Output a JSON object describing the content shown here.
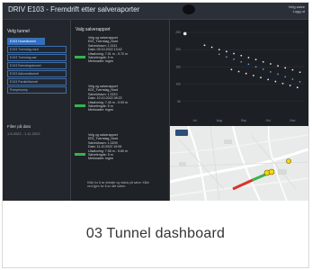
{
  "app": {
    "title": "DRIV E103 - Fremdrift etter salveraporter",
    "user_line1": "Velg salve",
    "user_line2": "Logg ut"
  },
  "left_panel": {
    "heading": "Velg tunnel",
    "tunnels": [
      "E103 Hovedtunnel",
      "E103 Tverrslag nord",
      "E103 Tverrslag sør",
      "E103 Rømningstunnel",
      "E103 Adkomsttunnel",
      "E103 Parallelltunnel",
      "Pumpesump"
    ],
    "filter_label": "Filter på dato",
    "filter_value": "1.6.2022 - 1.11.2022"
  },
  "middle_panel": {
    "heading": "Valg salverapport",
    "reports": [
      {
        "lines": [
          "Velg og salverapport",
          "E03_Tverrslag_Nord",
          "Salveidnavn: 1.0211",
          "Dato: 09.10.2022 13:42",
          "Utsalvning: 7.01 m - 9.72 m",
          "Salvelengde: 5 m",
          "Merknader: Ingen"
        ]
      },
      {
        "lines": [
          "Velg og salverapport",
          "E03_Tverrslag_Nord",
          "Salveidnavn: 1.0210",
          "Dato: 10.10.2022 08:22",
          "Utsalvning: 7.40 m - 9.93 m",
          "Salvelengde: 5 m",
          "Merknader: Ingen"
        ]
      },
      {
        "lines": [
          "Velg og salverapport",
          "E03_Tverrslag_Nord",
          "Salveidnavn: 1.0209",
          "Dato: 11.10.2022 10:06",
          "Utsalvning: 7.55 m - 9.60 m",
          "Salvelengde: 5 m",
          "Merknader: Ingen"
        ]
      }
    ],
    "footer": "Klikk for å se detaljer og status på salve. Klikk ned igjen for å se alle salver."
  },
  "chart_data": {
    "type": "scatter",
    "title": "",
    "xlabel": "",
    "ylabel": "",
    "x_ticks": [
      "Jul",
      "Aug",
      "Sep",
      "Oct",
      "Nov"
    ],
    "y_ticks": [
      "250",
      "200",
      "150",
      "100",
      "50"
    ],
    "ylim": [
      0,
      260
    ],
    "grid": true,
    "series": [
      {
        "color": "#e8edf3",
        "x": [
          0.18,
          0.24,
          0.3,
          0.36,
          0.42,
          0.48,
          0.54,
          0.6,
          0.66,
          0.72,
          0.78,
          0.84,
          0.9,
          0.96
        ],
        "y": [
          205,
          199,
          192,
          186,
          180,
          174,
          168,
          162,
          155,
          149,
          143,
          137,
          131,
          124
        ]
      },
      {
        "color": "#5b9bd5",
        "x": [
          0.3,
          0.36,
          0.42,
          0.48,
          0.54,
          0.6,
          0.66,
          0.72,
          0.78,
          0.84,
          0.9,
          0.96
        ],
        "y": [
          178,
          170,
          163,
          155,
          148,
          140,
          133,
          125,
          118,
          110,
          103,
          95
        ]
      },
      {
        "color": "#e8edf3",
        "x": [
          0.4,
          0.46,
          0.52,
          0.58,
          0.64,
          0.7,
          0.76,
          0.82,
          0.88,
          0.94
        ],
        "y": [
          132,
          126,
          120,
          114,
          108,
          102,
          96,
          90,
          84,
          78
        ]
      },
      {
        "color": "#e8edf3",
        "x": [
          0.02
        ],
        "y": [
          240
        ]
      }
    ]
  },
  "map": {
    "zoom_label": "+ -",
    "colors": {
      "tunnel_red": "#d9342b",
      "tunnel_green": "#37b24d",
      "marker_yellow": "#f5d90a",
      "road": "#ffffff"
    }
  },
  "caption": {
    "text": "03 Tunnel dashboard"
  },
  "colors": {
    "background": "#1b1e22",
    "accent_blue": "#2f6fc4",
    "status_green": "#37b24d"
  }
}
